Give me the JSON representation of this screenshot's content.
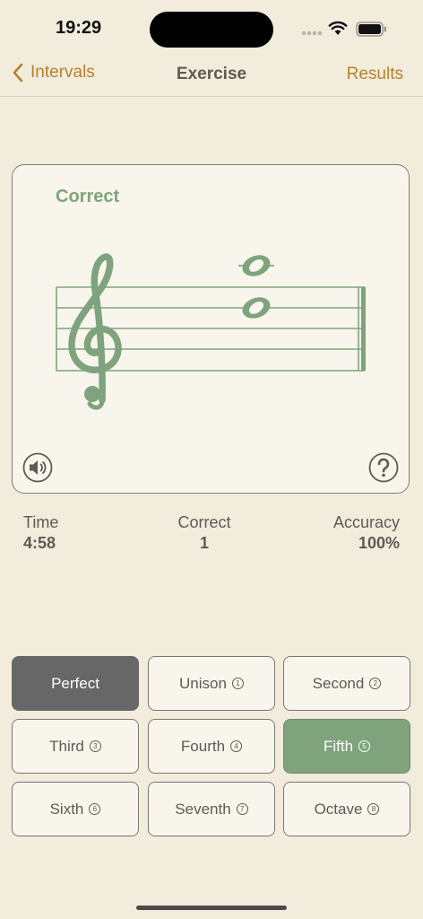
{
  "status_bar": {
    "time": "19:29"
  },
  "nav": {
    "back_label": "Intervals",
    "title": "Exercise",
    "results_label": "Results"
  },
  "staff_card": {
    "feedback": "Correct",
    "clef": "treble-clef",
    "speaker_icon": "speaker-icon",
    "help_icon": "question-icon"
  },
  "stats": {
    "time_label": "Time",
    "time_value": "4:58",
    "correct_label": "Correct",
    "correct_value": "1",
    "accuracy_label": "Accuracy",
    "accuracy_value": "100%"
  },
  "answers": [
    {
      "label": "Perfect",
      "num": "",
      "state": "selected-dark"
    },
    {
      "label": "Unison",
      "num": "1",
      "state": ""
    },
    {
      "label": "Second",
      "num": "2",
      "state": ""
    },
    {
      "label": "Third",
      "num": "3",
      "state": ""
    },
    {
      "label": "Fourth",
      "num": "4",
      "state": ""
    },
    {
      "label": "Fifth",
      "num": "5",
      "state": "selected-green"
    },
    {
      "label": "Sixth",
      "num": "6",
      "state": ""
    },
    {
      "label": "Seventh",
      "num": "7",
      "state": ""
    },
    {
      "label": "Octave",
      "num": "8",
      "state": ""
    }
  ],
  "colors": {
    "background": "#f2ecdc",
    "accent": "#b5812a",
    "staff_green": "#7fa47d",
    "selected_dark": "#676767"
  }
}
